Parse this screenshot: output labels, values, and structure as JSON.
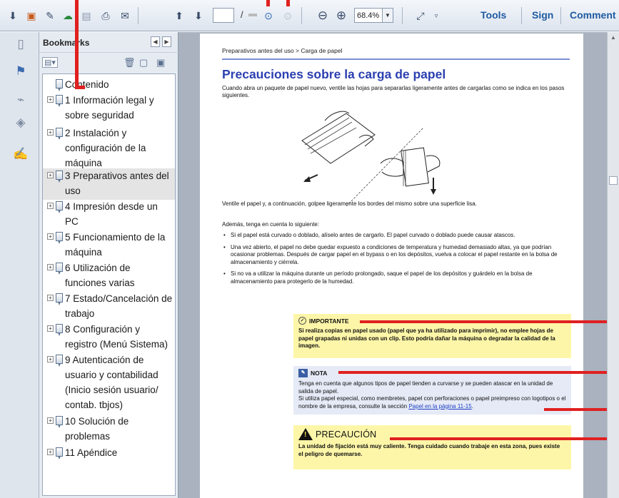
{
  "toolbar": {
    "page_separator": "/",
    "zoom_value": "68.4%",
    "tools_label": "Tools",
    "sign_label": "Sign",
    "comment_label": "Comment"
  },
  "bookmarks_pane": {
    "title": "Bookmarks",
    "items": [
      {
        "label": "Contenido",
        "expandable": false,
        "selected": false
      },
      {
        "label": "1 Información legal y sobre seguridad",
        "expandable": true,
        "selected": false
      },
      {
        "label": "2 Instalación y configuración de la máquina",
        "expandable": true,
        "selected": false
      },
      {
        "label": "3 Preparativos antes del uso",
        "expandable": true,
        "selected": true
      },
      {
        "label": "4 Impresión desde un PC",
        "expandable": true,
        "selected": false
      },
      {
        "label": "5 Funcionamiento de la máquina",
        "expandable": true,
        "selected": false
      },
      {
        "label": "6 Utilización de funciones varias",
        "expandable": true,
        "selected": false
      },
      {
        "label": "7 Estado/Cancelación de trabajo",
        "expandable": true,
        "selected": false
      },
      {
        "label": "8 Configuración y registro (Menú Sistema)",
        "expandable": true,
        "selected": false
      },
      {
        "label": "9 Autenticación de usuario y contabilidad (Inicio sesión usuario/ contab. tbjos)",
        "expandable": true,
        "selected": false
      },
      {
        "label": "10 Solución de problemas",
        "expandable": true,
        "selected": false
      },
      {
        "label": "11 Apéndice",
        "expandable": true,
        "selected": false
      }
    ]
  },
  "document": {
    "breadcrumb": "Preparativos antes del uso > Carga de papel",
    "title": "Precauciones sobre la carga de papel",
    "intro": "Cuando abra un paquete de papel nuevo, ventile las hojas para separarlas ligeramente antes de cargarlas como se indica en los pasos siguientes.",
    "fan_text": "Ventile el papel y, a continuación, golpee ligeramente los bordes del mismo sobre una superficie lisa.",
    "also_text": "Además, tenga en cuenta lo siguiente:",
    "bullets": [
      "Si el papel está curvado o doblado, alíselo antes de cargarlo. El papel curvado o doblado puede causar atascos.",
      "Una vez abierto, el papel no debe quedar expuesto a condiciones de temperatura y humedad demasiado altas, ya que podrían ocasionar problemas. Después de cargar papel en el bypass o en los depósitos, vuelva a colocar el papel restante en la bolsa de almacenamiento y ciérrela.",
      "Si no va a utilizar la máquina durante un período prolongado, saque el papel de los depósitos y guárdelo en la bolsa de almacenamiento para protegerlo de la humedad."
    ],
    "important": {
      "title": "IMPORTANTE",
      "body": "Si realiza copias en papel usado (papel que ya ha utilizado para imprimir), no emplee hojas de papel grapadas ni unidas con un clip. Esto podría dañar la máquina o degradar la calidad de la imagen."
    },
    "note": {
      "title": "NOTA",
      "line1": "Tenga en cuenta que algunos tipos de papel tienden a curvarse y se pueden atascar en la unidad de salida de papel.",
      "line2_prefix": "Si utiliza papel especial, como membretes, papel con perforaciones o papel preimpreso con logotipos o el nombre de la empresa, consulte la sección",
      "link": "Papel en la página 11-15",
      "line2_suffix": "."
    },
    "caution": {
      "title": "PRECAUCIÓN",
      "body": "La unidad de fijación está muy caliente. Tenga cuidado cuando trabaje en esta zona, pues existe el peligro de quemarse."
    }
  },
  "annotation_color": "#e02020",
  "accent_color": "#2b3fb0"
}
